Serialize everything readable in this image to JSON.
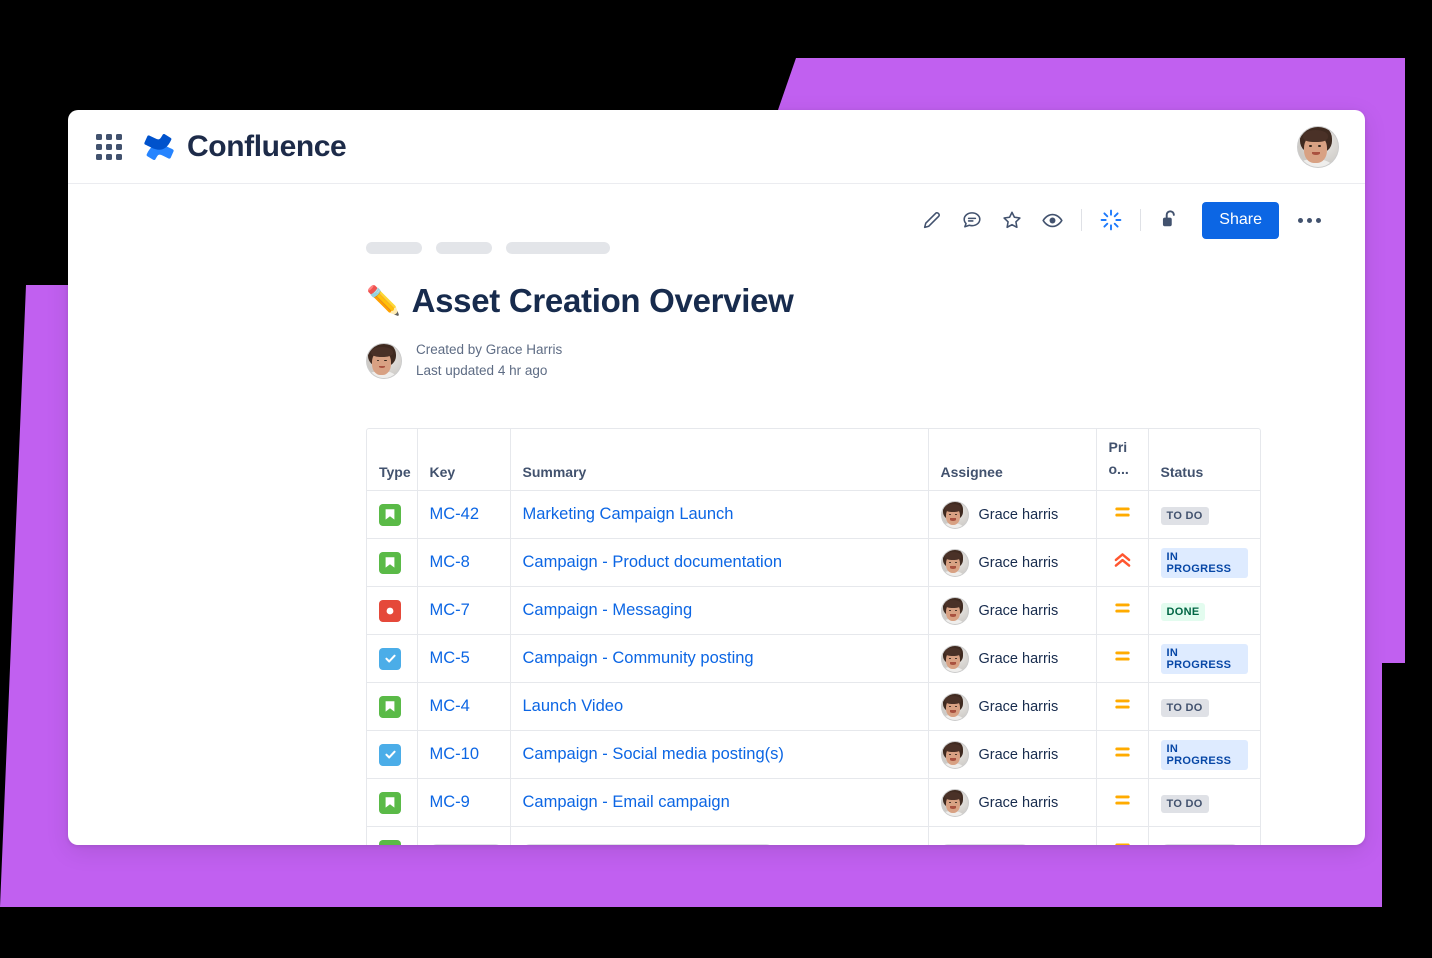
{
  "theme": {
    "accent_purple": "#c160f0",
    "brand_blue": "#0c66e4",
    "text_dark": "#172b4d",
    "text_muted": "#5e6c84"
  },
  "topnav": {
    "app_switcher_label": "App switcher",
    "product_name": "Confluence",
    "avatar_label": "Grace Harris"
  },
  "action_bar": {
    "edit_label": "Edit",
    "comment_label": "Comment",
    "star_label": "Star",
    "watch_label": "Watch",
    "ai_label": "Atlassian Intelligence",
    "restrictions_label": "Restrictions",
    "share_label": "Share",
    "more_label": "More actions"
  },
  "breadcrumb": {
    "items": [
      "",
      "",
      ""
    ]
  },
  "page_header": {
    "emoji": "✏️",
    "title": "Asset Creation Overview",
    "created_by": "Created by Grace Harris",
    "last_updated": "Last updated 4 hr ago"
  },
  "table": {
    "columns": [
      "Type",
      "Key",
      "Summary",
      "Assignee",
      "Pri o...",
      "Status"
    ],
    "priority_header_line1": "Pri",
    "priority_header_line2": "o...",
    "rows": [
      {
        "type": "story",
        "type_icon": "bookmark-icon",
        "type_color": "#5aba47",
        "key": "MC-42",
        "summary": "Marketing Campaign Launch",
        "assignee": "Grace harris",
        "priority": "medium",
        "priority_icon": "priority-medium-icon",
        "priority_color": "#ffab00",
        "status": "TO DO",
        "status_kind": "todo"
      },
      {
        "type": "story",
        "type_icon": "bookmark-icon",
        "type_color": "#5aba47",
        "key": "MC-8",
        "summary": "Campaign - Product documentation",
        "assignee": "Grace harris",
        "priority": "highest",
        "priority_icon": "priority-highest-icon",
        "priority_color": "#ff5630",
        "status": "IN PROGRESS",
        "status_kind": "inprogress"
      },
      {
        "type": "bug",
        "type_icon": "bug-circle-icon",
        "type_color": "#e5493a",
        "key": "MC-7",
        "summary": "Campaign - Messaging",
        "assignee": "Grace harris",
        "priority": "medium",
        "priority_icon": "priority-medium-icon",
        "priority_color": "#ffab00",
        "status": "DONE",
        "status_kind": "done"
      },
      {
        "type": "task",
        "type_icon": "check-square-icon",
        "type_color": "#4bade8",
        "key": "MC-5",
        "summary": "Campaign - Community posting",
        "assignee": "Grace harris",
        "priority": "medium",
        "priority_icon": "priority-medium-icon",
        "priority_color": "#ffab00",
        "status": "IN PROGRESS",
        "status_kind": "inprogress"
      },
      {
        "type": "story",
        "type_icon": "bookmark-icon",
        "type_color": "#5aba47",
        "key": "MC-4",
        "summary": "Launch Video",
        "assignee": "Grace harris",
        "priority": "medium",
        "priority_icon": "priority-medium-icon",
        "priority_color": "#ffab00",
        "status": "TO DO",
        "status_kind": "todo"
      },
      {
        "type": "task",
        "type_icon": "check-square-icon",
        "type_color": "#4bade8",
        "key": "MC-10",
        "summary": "Campaign - Social media posting(s)",
        "assignee": "Grace harris",
        "priority": "medium",
        "priority_icon": "priority-medium-icon",
        "priority_color": "#ffab00",
        "status": "IN PROGRESS",
        "status_kind": "inprogress"
      },
      {
        "type": "story",
        "type_icon": "bookmark-icon",
        "type_color": "#5aba47",
        "key": "MC-9",
        "summary": "Campaign - Email campaign",
        "assignee": "Grace harris",
        "priority": "medium",
        "priority_icon": "priority-medium-icon",
        "priority_color": "#ffab00",
        "status": "TO DO",
        "status_kind": "todo"
      }
    ],
    "loading_row": {
      "type": "story",
      "type_color": "#5aba47",
      "priority_color": "#ffab00"
    }
  }
}
